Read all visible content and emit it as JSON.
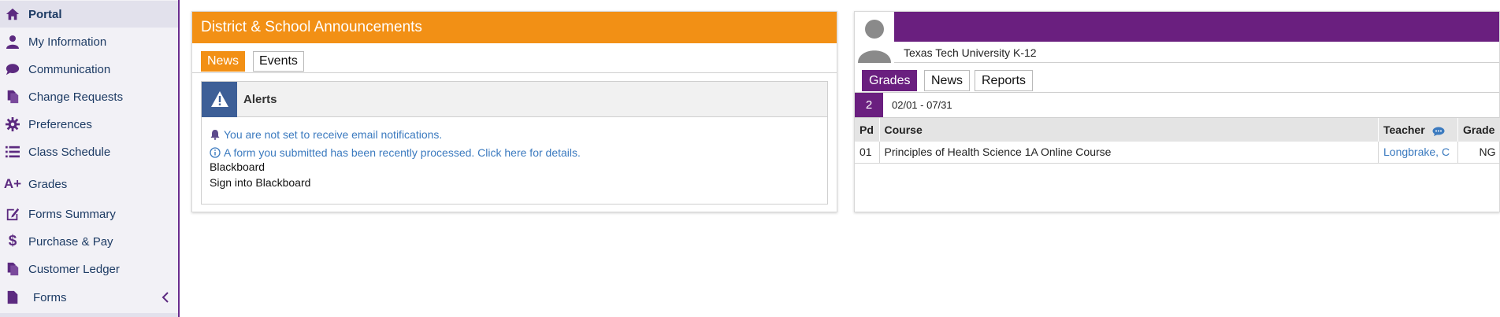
{
  "sidebar": {
    "items": [
      {
        "label": "Portal",
        "icon": "home-icon"
      },
      {
        "label": "My Information",
        "icon": "user-icon"
      },
      {
        "label": "Communication",
        "icon": "chat-bubble-icon"
      },
      {
        "label": "Change Requests",
        "icon": "documents-icon"
      },
      {
        "label": "Preferences",
        "icon": "gear-icon"
      },
      {
        "label": "Class Schedule",
        "icon": "list-icon"
      },
      {
        "label": "Grades",
        "icon": "a-plus-icon"
      },
      {
        "label": "Forms Summary",
        "icon": "edit-form-icon"
      },
      {
        "label": "Purchase & Pay",
        "icon": "dollar-icon"
      },
      {
        "label": "Customer Ledger",
        "icon": "ledger-icon"
      },
      {
        "label": "Forms",
        "icon": "file-icon"
      }
    ],
    "accent_color": "#6a2c8e"
  },
  "announcements": {
    "title": "District & School Announcements",
    "header_color": "#f29015",
    "tabs": [
      {
        "label": "News",
        "active": true
      },
      {
        "label": "Events",
        "active": false
      }
    ],
    "alerts": {
      "title": "Alerts",
      "email_notice": "You are not set to receive email notifications.",
      "form_notice": "A form you submitted has been recently processed. Click here for details.",
      "section_label": "Blackboard",
      "section_link": "Sign into Blackboard"
    }
  },
  "grades_panel": {
    "school": "Texas Tech University K-12",
    "banner_color": "#6a1f7f",
    "tabs": [
      {
        "label": "Grades",
        "active": true
      },
      {
        "label": "News",
        "active": false
      },
      {
        "label": "Reports",
        "active": false
      }
    ],
    "term": {
      "number": "2",
      "range": "02/01 - 07/31"
    },
    "columns": {
      "pd": "Pd",
      "course": "Course",
      "teacher": "Teacher",
      "grade": "Grade"
    },
    "rows": [
      {
        "pd": "01",
        "course": "Principles of Health Science 1A Online Course",
        "teacher": "Longbrake, C",
        "grade": "NG"
      }
    ]
  }
}
